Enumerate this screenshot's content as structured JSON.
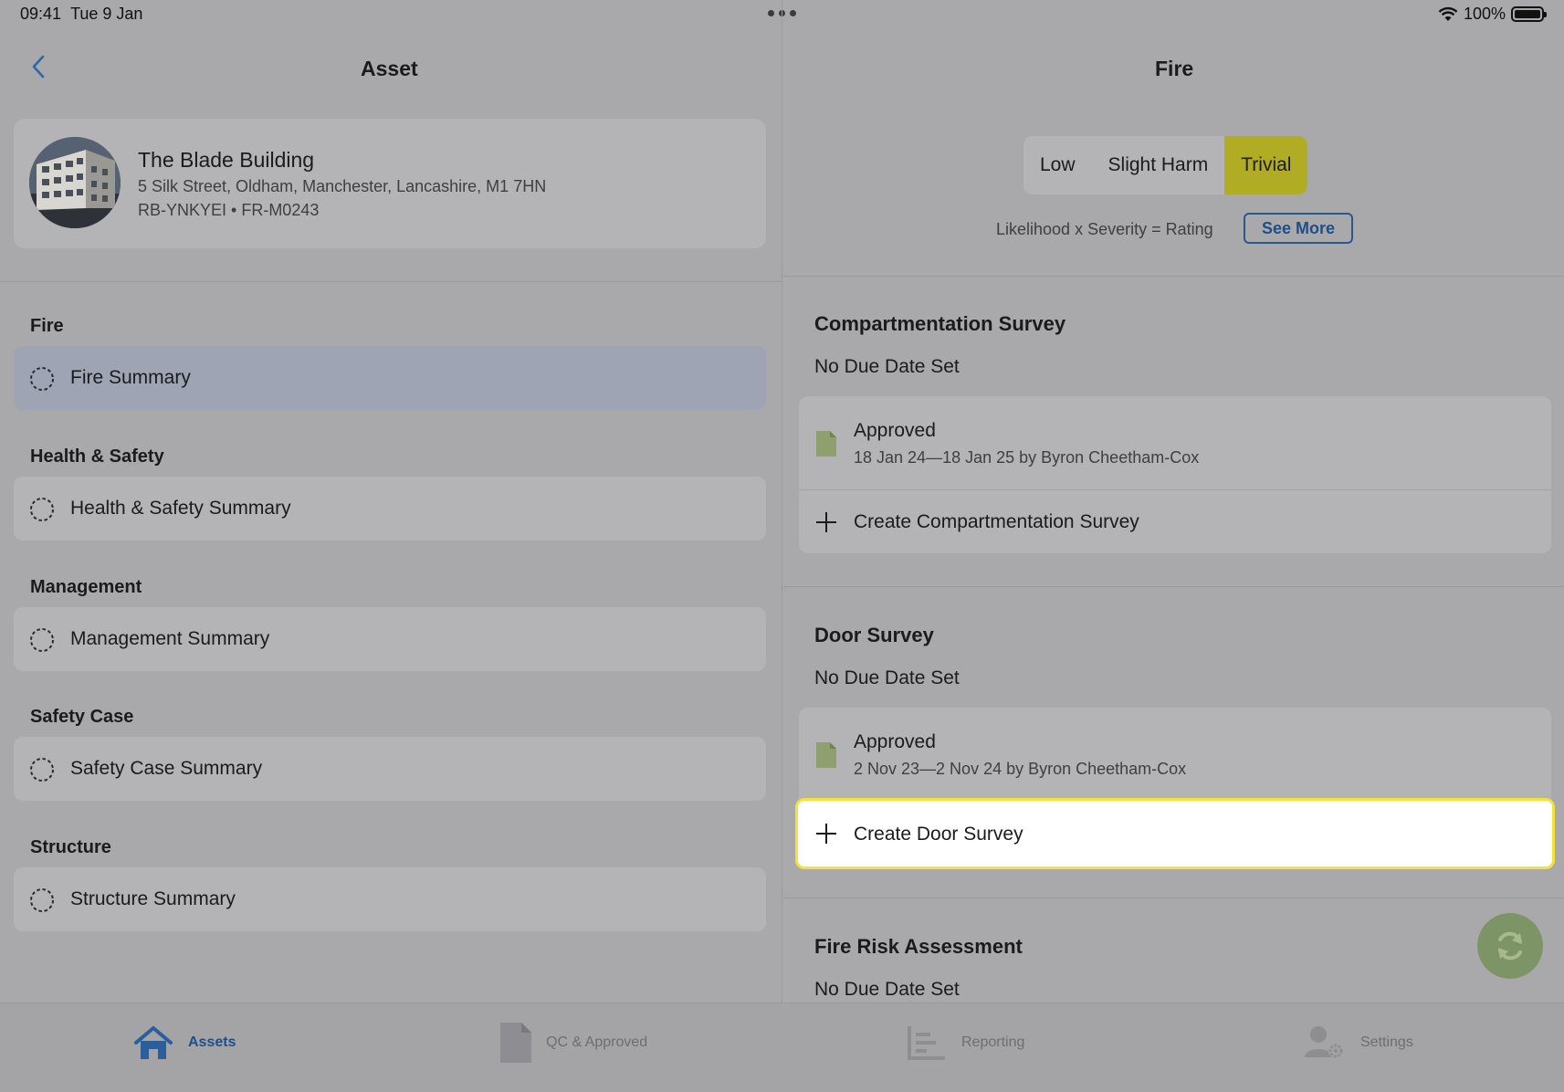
{
  "status_bar": {
    "time": "09:41",
    "date": "Tue 9 Jan",
    "battery": "100%"
  },
  "left": {
    "title": "Asset",
    "asset": {
      "name": "The Blade Building",
      "address": "5 Silk Street, Oldham, Manchester, Lancashire, M1 7HN",
      "refs": "RB-YNKYEI • FR-M0243"
    },
    "sections": [
      {
        "label": "Fire",
        "item": "Fire Summary",
        "selected": true
      },
      {
        "label": "Health & Safety",
        "item": "Health & Safety Summary",
        "selected": false
      },
      {
        "label": "Management",
        "item": "Management Summary",
        "selected": false
      },
      {
        "label": "Safety Case",
        "item": "Safety Case Summary",
        "selected": false
      },
      {
        "label": "Structure",
        "item": "Structure Summary",
        "selected": false
      }
    ]
  },
  "right": {
    "title": "Fire",
    "rating": {
      "likelihood": "Low",
      "severity": "Slight Harm",
      "result": "Trivial",
      "result_color": "#b0ad24"
    },
    "formula": "Likelihood x Severity = Rating",
    "see_more": "See More",
    "surveys": [
      {
        "title": "Compartmentation Survey",
        "due": "No Due Date Set",
        "status": "Approved",
        "period": "18 Jan 24—18 Jan 25 by Byron Cheetham-Cox",
        "create_label": "Create Compartmentation Survey"
      },
      {
        "title": "Door Survey",
        "due": "No Due Date Set",
        "status": "Approved",
        "period": "2 Nov 23—2 Nov 24 by Byron Cheetham-Cox",
        "create_label": "Create Door Survey"
      },
      {
        "title": "Fire Risk Assessment",
        "due": "No Due Date Set"
      }
    ]
  },
  "tabs": [
    {
      "label": "Assets",
      "icon": "home-icon",
      "active": true
    },
    {
      "label": "QC & Approved",
      "icon": "document-icon",
      "active": false
    },
    {
      "label": "Reporting",
      "icon": "report-icon",
      "active": false
    },
    {
      "label": "Settings",
      "icon": "user-settings-icon",
      "active": false
    }
  ],
  "colors": {
    "accent": "#1f4f8a",
    "trivial": "#b0ad24",
    "highlight_border": "#f2e23a",
    "fab": "#7d9467"
  }
}
